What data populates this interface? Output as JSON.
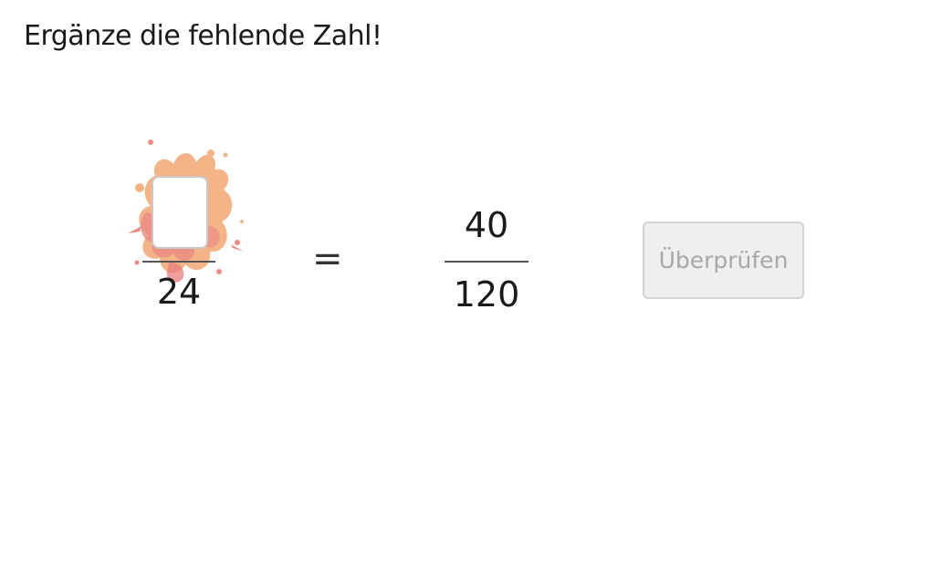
{
  "prompt": "Ergänze die fehlende Zahl!",
  "left_fraction": {
    "numerator_value": "",
    "denominator": "24"
  },
  "equals_sign": "=",
  "right_fraction": {
    "numerator": "40",
    "denominator": "120"
  },
  "check_button": {
    "label": "Überprüfen",
    "disabled": true
  },
  "colors": {
    "splash_primary": "#f0a070",
    "splash_secondary": "#e87070",
    "button_bg": "#efefef",
    "button_text": "#a8a8a8"
  }
}
